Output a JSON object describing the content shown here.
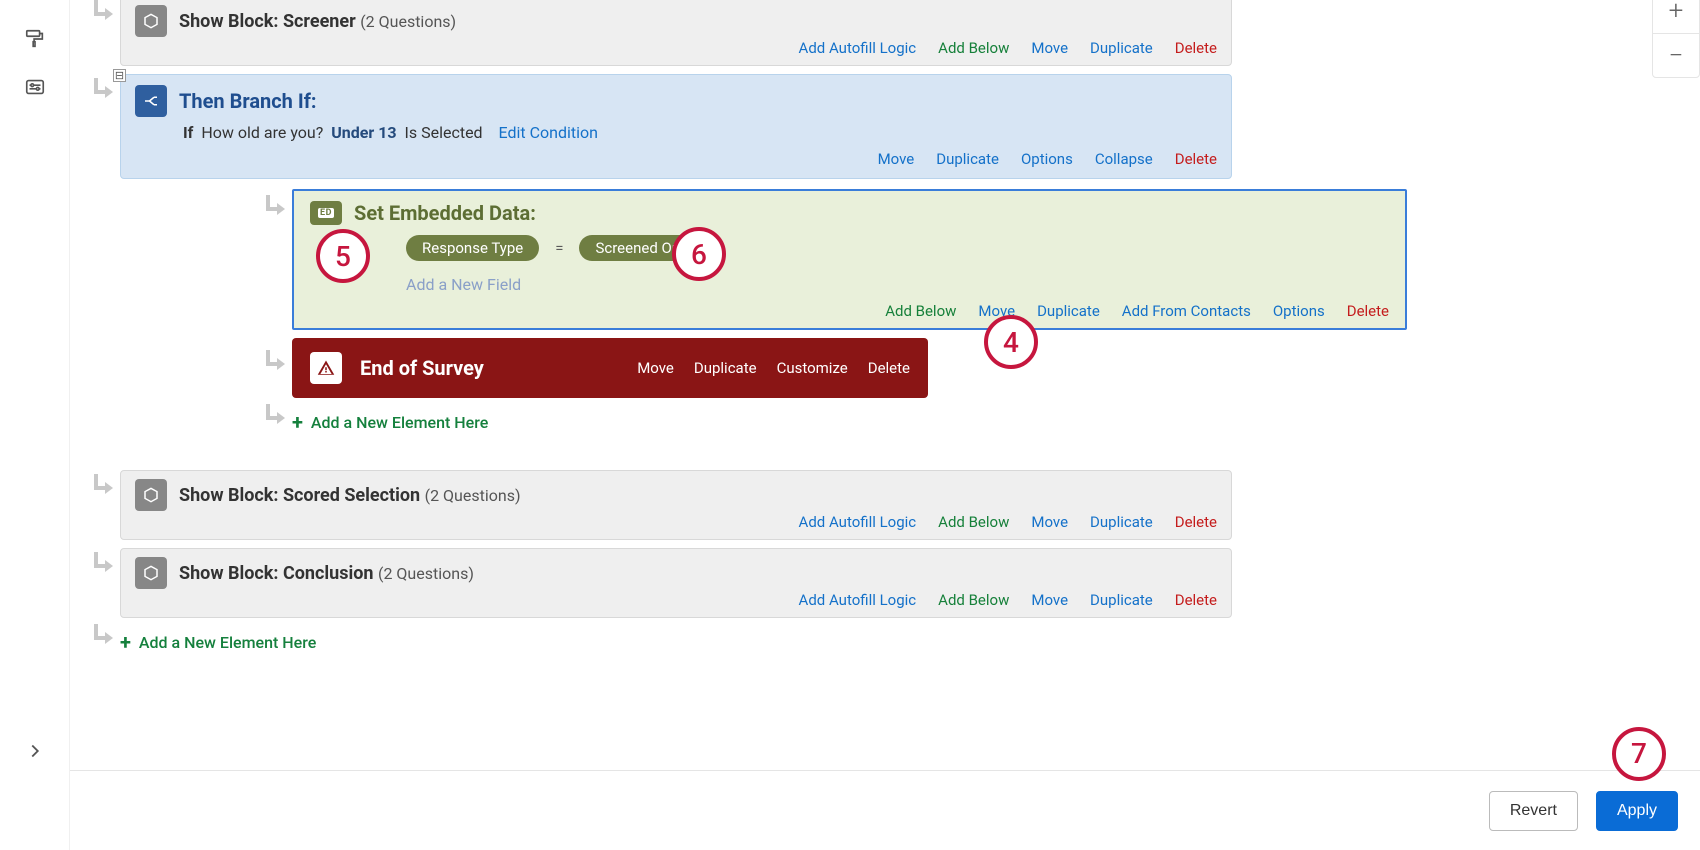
{
  "leftRail": {
    "icons": [
      "paint-roller-icon",
      "sliders-icon"
    ],
    "chevron": "chevron-right-icon"
  },
  "zoom": {
    "plus": "+",
    "minus": "−"
  },
  "blocks": {
    "screener": {
      "titlePrefix": "Show Block: ",
      "name": "Screener",
      "count": "(2 Questions)",
      "actions": {
        "autofill": "Add Autofill Logic",
        "addBelow": "Add Below",
        "move": "Move",
        "duplicate": "Duplicate",
        "delete": "Delete"
      }
    },
    "branch": {
      "title": "Then Branch If:",
      "ifLabel": "If",
      "question": "How old are you?",
      "answer": "Under 13",
      "stateLabel": "Is Selected",
      "editCondition": "Edit Condition",
      "actions": {
        "move": "Move",
        "duplicate": "Duplicate",
        "options": "Options",
        "collapse": "Collapse",
        "delete": "Delete"
      },
      "toggle": "⊟"
    },
    "embedded": {
      "iconLabel": "ED",
      "title": "Set Embedded Data:",
      "fieldName": "Response Type",
      "equals": "=",
      "fieldValue": "Screened Out",
      "addField": "Add a New Field",
      "actions": {
        "addBelow": "Add Below",
        "move": "Move",
        "duplicate": "Duplicate",
        "addFromContacts": "Add From Contacts",
        "options": "Options",
        "delete": "Delete"
      }
    },
    "eos": {
      "title": "End of Survey",
      "actions": {
        "move": "Move",
        "duplicate": "Duplicate",
        "customize": "Customize",
        "delete": "Delete"
      }
    },
    "addElementNested": "Add a New Element Here",
    "scored": {
      "titlePrefix": "Show Block: ",
      "name": "Scored Selection",
      "count": "(2 Questions)",
      "actions": {
        "autofill": "Add Autofill Logic",
        "addBelow": "Add Below",
        "move": "Move",
        "duplicate": "Duplicate",
        "delete": "Delete"
      }
    },
    "conclusion": {
      "titlePrefix": "Show Block: ",
      "name": "Conclusion",
      "count": "(2 Questions)",
      "actions": {
        "autofill": "Add Autofill Logic",
        "addBelow": "Add Below",
        "move": "Move",
        "duplicate": "Duplicate",
        "delete": "Delete"
      }
    },
    "addElementRoot": "Add a New Element Here"
  },
  "footer": {
    "revert": "Revert",
    "apply": "Apply"
  },
  "annotations": {
    "a4": "4",
    "a5": "5",
    "a6": "6",
    "a7": "7"
  }
}
